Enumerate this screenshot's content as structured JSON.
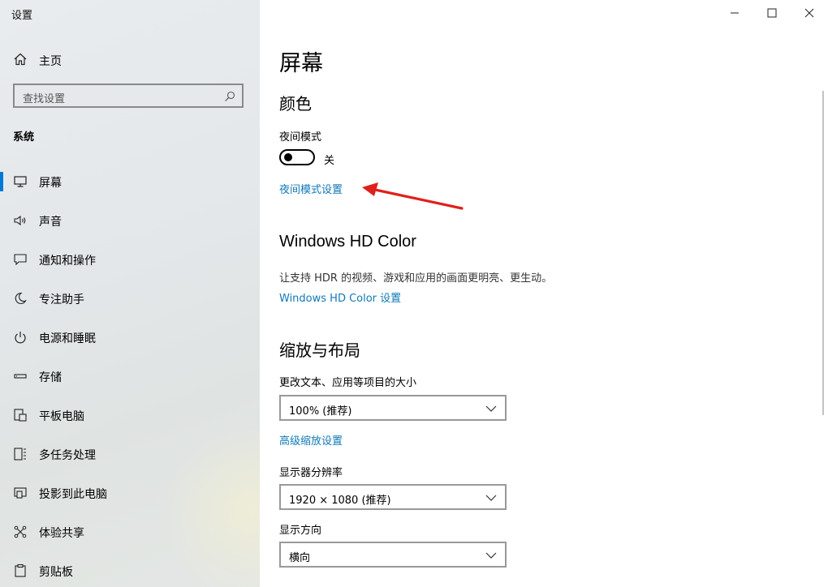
{
  "window": {
    "title": "设置"
  },
  "sidebar": {
    "home_label": "主页",
    "search_placeholder": "查找设置",
    "section_title": "系统",
    "items": [
      {
        "label": "屏幕",
        "icon": "monitor-icon",
        "active": true
      },
      {
        "label": "声音",
        "icon": "speaker-icon"
      },
      {
        "label": "通知和操作",
        "icon": "notification-icon"
      },
      {
        "label": "专注助手",
        "icon": "moon-icon"
      },
      {
        "label": "电源和睡眠",
        "icon": "power-icon"
      },
      {
        "label": "存储",
        "icon": "storage-icon"
      },
      {
        "label": "平板电脑",
        "icon": "tablet-icon"
      },
      {
        "label": "多任务处理",
        "icon": "multitask-icon"
      },
      {
        "label": "投影到此电脑",
        "icon": "project-icon"
      },
      {
        "label": "体验共享",
        "icon": "share-icon"
      },
      {
        "label": "剪贴板",
        "icon": "clipboard-icon"
      }
    ]
  },
  "main": {
    "page_title": "屏幕",
    "color": {
      "heading": "颜色",
      "night_mode_label": "夜间模式",
      "night_mode_state": "关",
      "night_mode_on": false,
      "night_mode_link": "夜间模式设置"
    },
    "hdr": {
      "heading": "Windows HD Color",
      "description": "让支持 HDR 的视频、游戏和应用的画面更明亮、更生动。",
      "link": "Windows HD Color 设置"
    },
    "scale": {
      "heading": "缩放与布局",
      "size_label": "更改文本、应用等项目的大小",
      "size_value": "100% (推荐)",
      "advanced_link": "高级缩放设置",
      "resolution_label": "显示器分辨率",
      "resolution_value": "1920 × 1080 (推荐)",
      "orientation_label": "显示方向",
      "orientation_value": "横向"
    }
  },
  "colors": {
    "accent": "#0078d7",
    "link": "#1079b5",
    "annotation_arrow": "#e0201b"
  }
}
